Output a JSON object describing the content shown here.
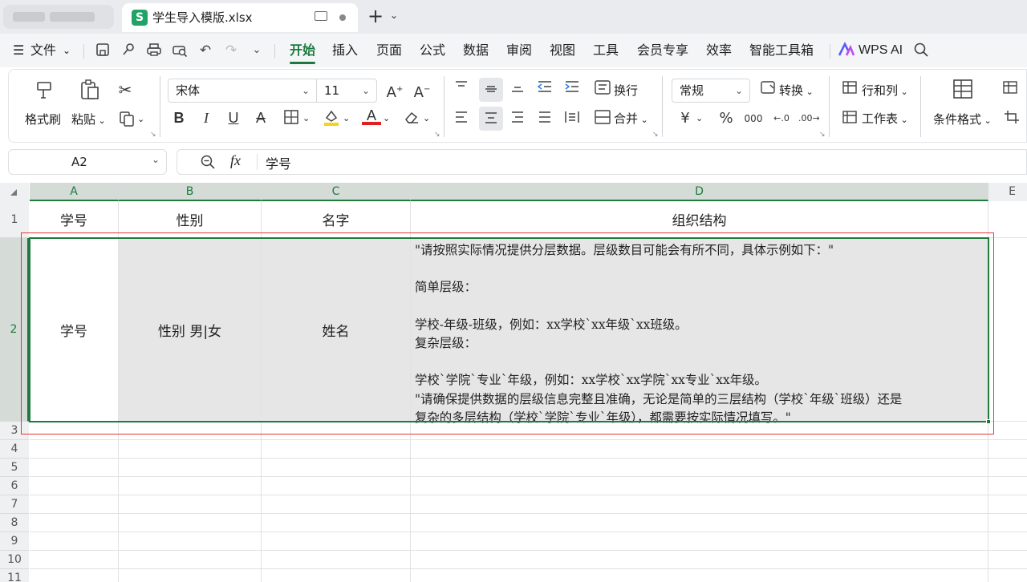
{
  "window": {
    "file_tab_title": "学生导入模版.xlsx",
    "sheet_logo": "S",
    "new_tab_symbol": "+",
    "tab_menu_symbol": "⌄"
  },
  "menubar": {
    "hamburger": "☰",
    "file_label": "文件",
    "file_chevron": "⌄",
    "tabs": [
      "开始",
      "插入",
      "页面",
      "公式",
      "数据",
      "审阅",
      "视图",
      "工具",
      "会员专享",
      "效率",
      "智能工具箱"
    ],
    "active_tab": "开始",
    "wps_ai": "WPS AI"
  },
  "ribbon": {
    "format_painter": "格式刷",
    "paste": "粘贴",
    "font_name": "宋体",
    "font_size": "11",
    "wrap_text": "换行",
    "merge": "合并",
    "number_format": "常规",
    "convert": "转换",
    "row_col": "行和列",
    "worksheet": "工作表",
    "conditional_format": "条件格式",
    "bold": "B",
    "italic": "I",
    "underline": "U",
    "font_color_accent": "#e02020",
    "highlight_accent": "#f5d21c",
    "percent": "%",
    "currency": "¥"
  },
  "formula_bar": {
    "cell_ref": "A2",
    "fx": "fx",
    "content": "学号"
  },
  "grid": {
    "columns": [
      "A",
      "B",
      "C",
      "D",
      "E"
    ],
    "rows": [
      "1",
      "2",
      "3",
      "4",
      "5",
      "6",
      "7",
      "8",
      "9",
      "10",
      "11"
    ],
    "header_row": [
      "学号",
      "性别",
      "名字",
      "组织结构"
    ],
    "row2": {
      "a": "学号",
      "b": "性别 男|女",
      "c": "姓名",
      "d_lines": [
        "\"请按照实际情况提供分层数据。层级数目可能会有所不同，具体示例如下：\"",
        "",
        "简单层级：",
        "",
        "学校-年级-班级，例如：xx学校`xx年级`xx班级。",
        "复杂层级：",
        "",
        "学校`学院`专业`年级，例如：xx学校`xx学院`xx专业`xx年级。",
        "\"请确保提供数据的层级信息完整且准确，无论是简单的三层结构（学校`年级`班级）还是",
        "复杂的多层结构（学校`学院`专业`年级），都需要按实际情况填写。\""
      ]
    },
    "selection_color": "#1f7a3d",
    "annotation_color": "#e53935"
  }
}
